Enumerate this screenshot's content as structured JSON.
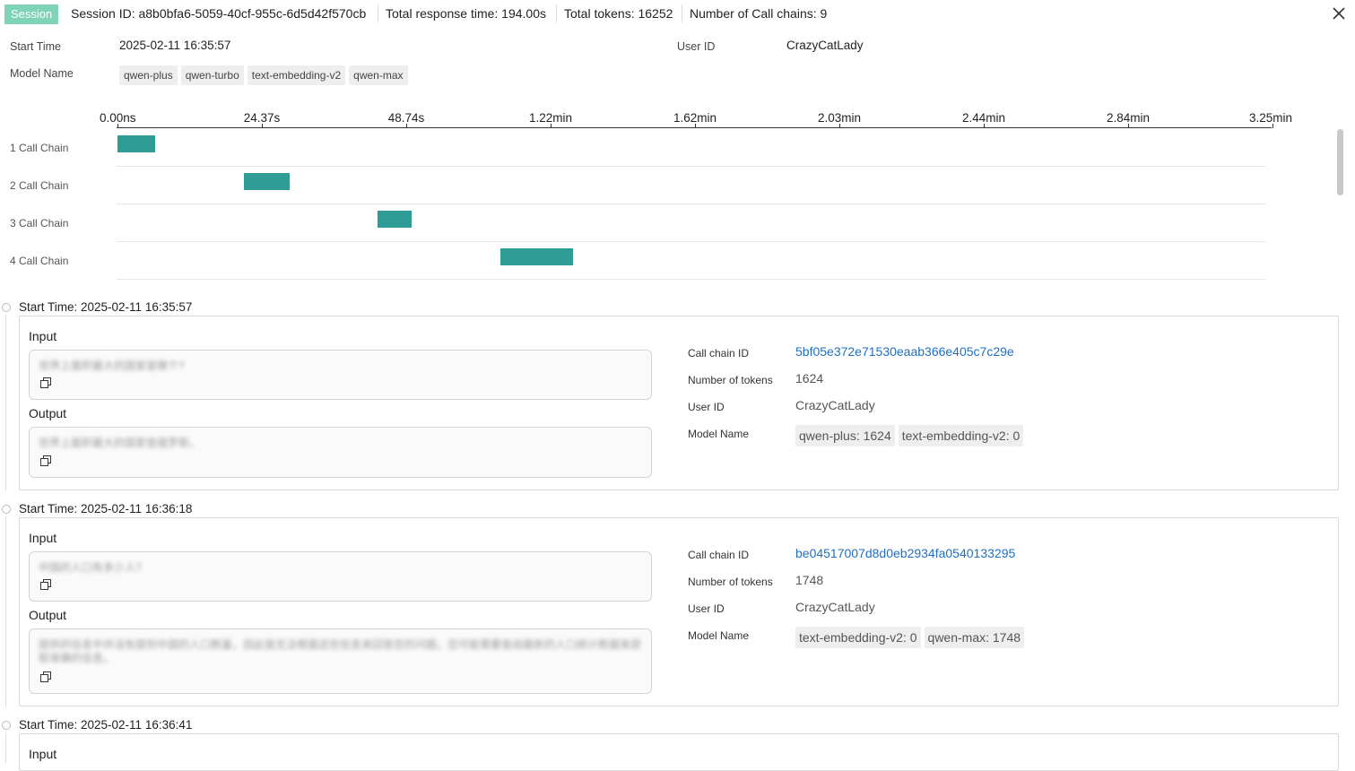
{
  "header": {
    "badge": "Session",
    "session_id": "Session ID: a8b0bfa6-5059-40cf-955c-6d5d42f570cb",
    "total_response_time": "Total response time: 194.00s",
    "total_tokens": "Total tokens: 16252",
    "call_chains": "Number of Call chains: 9"
  },
  "summary": {
    "start_time_label": "Start Time",
    "start_time": "2025-02-11 16:35:57",
    "user_id_label": "User ID",
    "user_id": "CrazyCatLady",
    "model_name_label": "Model Name",
    "models": [
      "qwen-plus",
      "qwen-turbo",
      "text-embedding-v2",
      "qwen-max"
    ]
  },
  "chart_data": {
    "type": "gantt",
    "x_ticks": [
      "0.00ns",
      "24.37s",
      "48.74s",
      "1.22min",
      "1.62min",
      "2.03min",
      "2.44min",
      "2.84min",
      "3.25min"
    ],
    "xlim_seconds": [
      0,
      195
    ],
    "rows": [
      {
        "label": "1 Call Chain",
        "start_s": 0,
        "end_s": 6.3
      },
      {
        "label": "2 Call Chain",
        "start_s": 21.3,
        "end_s": 29.0
      },
      {
        "label": "3 Call Chain",
        "start_s": 43.9,
        "end_s": 49.6
      },
      {
        "label": "4 Call Chain",
        "start_s": 64.6,
        "end_s": 76.9
      }
    ]
  },
  "entries": [
    {
      "start_time": "Start Time: 2025-02-11 16:35:57",
      "input_label": "Input",
      "input_text": "世界上面积最大的国家是哪个?",
      "output_label": "Output",
      "output_text": "世界上面积最大的国家是俄罗斯。",
      "chain_id_label": "Call chain ID",
      "chain_id": "5bf05e372e71530eaab366e405c7c29e",
      "tokens_label": "Number of tokens",
      "tokens": "1624",
      "user_id_label": "User ID",
      "user_id": "CrazyCatLady",
      "model_label": "Model Name",
      "models": [
        "qwen-plus: 1624",
        "text-embedding-v2: 0"
      ]
    },
    {
      "start_time": "Start Time: 2025-02-11 16:36:18",
      "input_label": "Input",
      "input_text": "中国的人口有多少人?",
      "output_label": "Output",
      "output_text": "提供的信息中并没有提到中国的人口数量，因此我无法根据这些信息来回答您的问题。您可能需要查阅最新的人口统计数据来获取准确的信息。",
      "chain_id_label": "Call chain ID",
      "chain_id": "be04517007d8d0eb2934fa0540133295",
      "tokens_label": "Number of tokens",
      "tokens": "1748",
      "user_id_label": "User ID",
      "user_id": "CrazyCatLady",
      "model_label": "Model Name",
      "models": [
        "text-embedding-v2: 0",
        "qwen-max: 1748"
      ]
    },
    {
      "start_time": "Start Time: 2025-02-11 16:36:41",
      "input_label": "Input"
    }
  ]
}
